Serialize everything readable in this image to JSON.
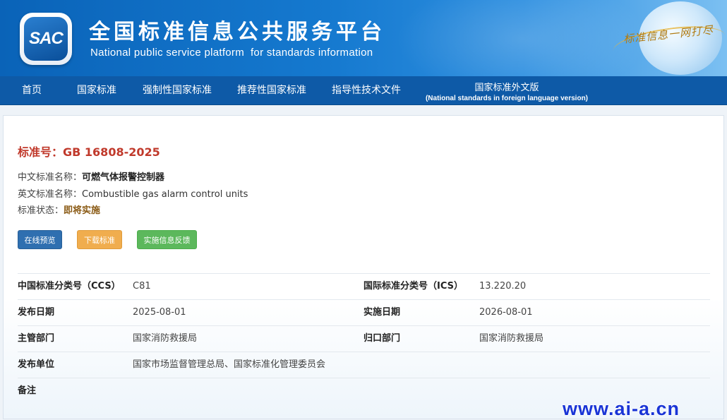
{
  "header": {
    "logo_text": "SAC",
    "title": "全国标准信息公共服务平台",
    "subtitle": "National public service platform  for standards information",
    "slogan": "标准信息一网打尽"
  },
  "nav": {
    "items": [
      {
        "label": "首页"
      },
      {
        "label": "国家标准"
      },
      {
        "label": "强制性国家标准"
      },
      {
        "label": "推荐性国家标准"
      },
      {
        "label": "指导性技术文件"
      }
    ],
    "foreign": {
      "label": "国家标准外文版",
      "sublabel": "(National standards in foreign language version)"
    }
  },
  "standard": {
    "number_label": "标准号：",
    "number": "GB 16808-2025",
    "cn_name_label": "中文标准名称：",
    "cn_name": "可燃气体报警控制器",
    "en_name_label": "英文标准名称：",
    "en_name": "Combustible gas alarm control units",
    "status_label": "标准状态：",
    "status": "即将实施"
  },
  "buttons": {
    "preview": "在线预览",
    "download": "下载标准",
    "feedback": "实施信息反馈"
  },
  "details": [
    {
      "k1": "中国标准分类号（CCS）",
      "v1": "C81",
      "k2": "国际标准分类号（ICS）",
      "v2": "13.220.20"
    },
    {
      "k1": "发布日期",
      "v1": "2025-08-01",
      "k2": "实施日期",
      "v2": "2026-08-01"
    },
    {
      "k1": "主管部门",
      "v1": "国家消防救援局",
      "k2": "归口部门",
      "v2": "国家消防救援局"
    },
    {
      "k1": "发布单位",
      "v1": "国家市场监督管理总局、国家标准化管理委员会",
      "k2": "",
      "v2": ""
    },
    {
      "k1": "备注",
      "v1": "",
      "k2": "",
      "v2": ""
    }
  ],
  "watermark": "www.ai-a.cn",
  "colors": {
    "nav_bg": "#0e5aa7",
    "standard_number": "#c0392b",
    "btn_preview": "#2f6fb0",
    "btn_download": "#f0ad4e",
    "btn_feedback": "#5cb85c"
  }
}
